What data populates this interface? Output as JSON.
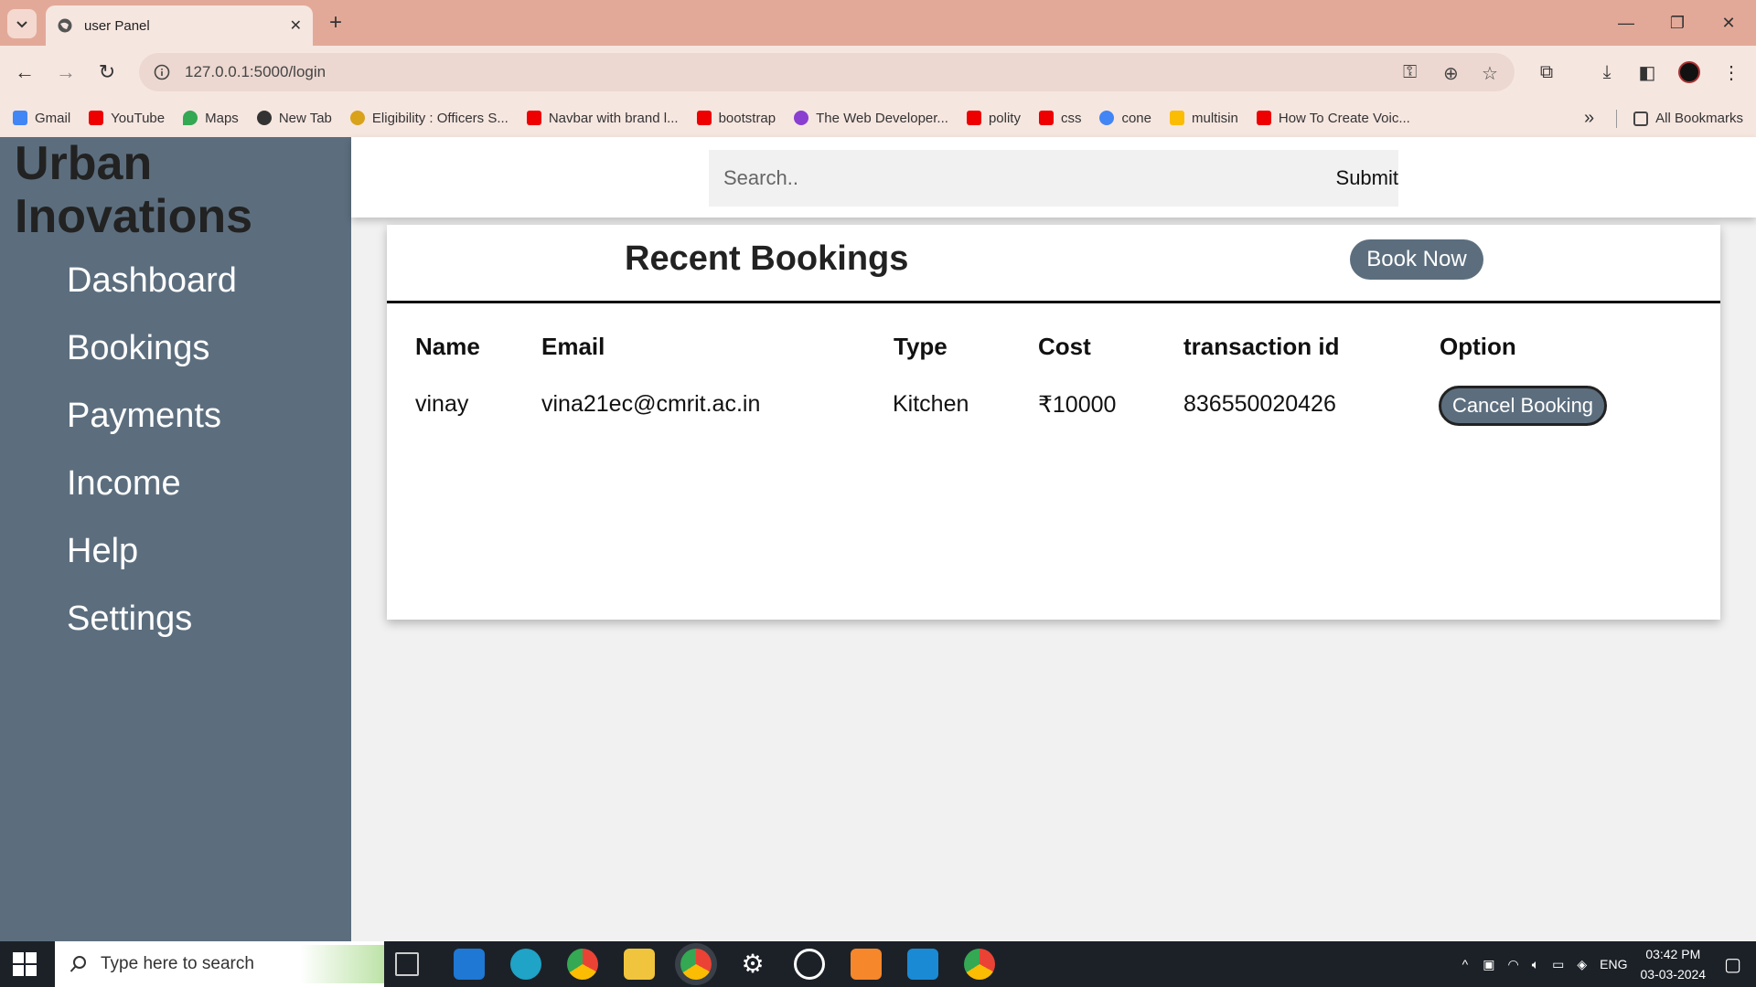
{
  "browser": {
    "tab_title": "user Panel",
    "url": "127.0.0.1:5000/login",
    "bookmarks": [
      "Gmail",
      "YouTube",
      "Maps",
      "New Tab",
      "Eligibility : Officers S...",
      "Navbar with brand l...",
      "bootstrap",
      "The Web Developer...",
      "polity",
      "css",
      "cone",
      "multisin",
      "How To Create Voic..."
    ],
    "all_bookmarks": "All Bookmarks"
  },
  "app": {
    "brand": "Urban Inovations",
    "nav": [
      "Dashboard",
      "Bookings",
      "Payments",
      "Income",
      "Help",
      "Settings"
    ],
    "search_placeholder": "Search..",
    "submit_label": "Submit",
    "card_title": "Recent Bookings",
    "book_now_label": "Book Now",
    "columns": [
      "Name",
      "Email",
      "Type",
      "Cost",
      "transaction id",
      "Option"
    ],
    "rows": [
      {
        "name": "vinay",
        "email": "vina21ec@cmrit.ac.in",
        "type": "Kitchen",
        "cost": "₹10000",
        "transaction_id": "836550020426",
        "option": "Cancel Booking"
      }
    ]
  },
  "taskbar": {
    "search_placeholder": "Type here to search",
    "lang": "ENG",
    "time": "03:42 PM",
    "date": "03-03-2024"
  },
  "colors": {
    "sidebar": "#5c6e7e",
    "titlebar": "#e3a998",
    "button": "#5c6e7e"
  }
}
